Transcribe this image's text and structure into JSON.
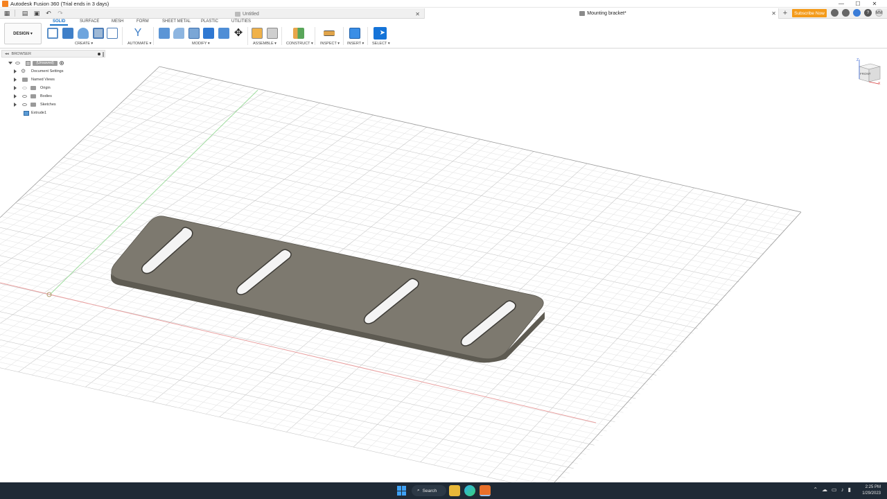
{
  "window": {
    "title": "Autodesk Fusion 360 (Trial ends in 3 days)",
    "controls": [
      "—",
      "☐",
      "✕"
    ]
  },
  "tabs": {
    "inactive_label": "Untitled",
    "active_label": "Mounting bracket*",
    "close_glyph": "✕",
    "new_tab_glyph": "+",
    "subscribe_label": "Subscribe Now",
    "avatar_initials": "MM"
  },
  "ribbon": {
    "workspace_label": "DESIGN ▾",
    "tabs": [
      "SOLID",
      "SURFACE",
      "MESH",
      "FORM",
      "SHEET METAL",
      "PLASTIC",
      "UTILITIES"
    ],
    "groups": [
      "CREATE ▾",
      "AUTOMATE ▾",
      "MODIFY ▾",
      "ASSEMBLE ▾",
      "CONSTRUCT ▾",
      "INSPECT ▾",
      "INSERT ▾",
      "SELECT ▾"
    ]
  },
  "browser": {
    "title": "BROWSER",
    "root_label": "(Unsaved)",
    "items": [
      "Document Settings",
      "Named Views",
      "Origin",
      "Bodies",
      "Sketches",
      "Extrude1"
    ]
  },
  "viewcube": {
    "face_label": "FRONT",
    "axis_z": "Z",
    "axis_x": "X"
  },
  "taskbar": {
    "search_label": "Search",
    "time": "2:25 PM",
    "date": "1/29/2023"
  },
  "colors": {
    "accent": "#1a73c8",
    "subscribe": "#f49b1a",
    "body_top": "#7b776c",
    "body_side": "#5f5c53",
    "grid": "#d9d9d9",
    "taskbar": "#1f2a36"
  }
}
